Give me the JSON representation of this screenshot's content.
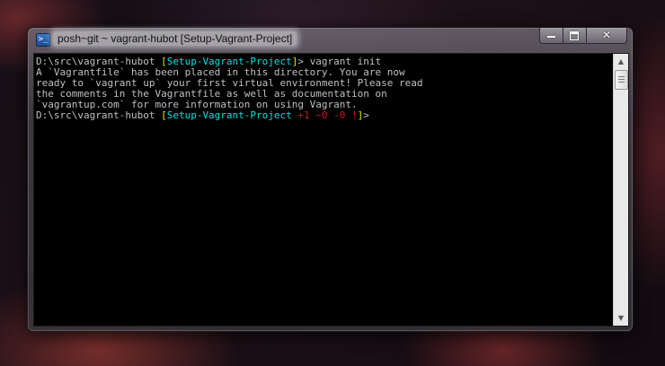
{
  "window": {
    "title": "posh~git ~ vagrant-hubot [Setup-Vagrant-Project]",
    "icon": "powershell-icon",
    "controls": {
      "minimize": "minimize-icon",
      "maximize": "maximize-icon",
      "close_label": "✕"
    }
  },
  "console": {
    "prompt1": {
      "path": "D:\\src\\vagrant-hubot ",
      "open_bracket": "[",
      "branch": "Setup-Vagrant-Project",
      "close_bracket": "]",
      "command": "> vagrant init"
    },
    "output": [
      "A `Vagrantfile` has been placed in this directory. You are now",
      "ready to `vagrant up` your first virtual environment! Please read",
      "the comments in the Vagrantfile as well as documentation on",
      "`vagrantup.com` for more information on using Vagrant."
    ],
    "prompt2": {
      "path": "D:\\src\\vagrant-hubot ",
      "open_bracket": "[",
      "branch": "Setup-Vagrant-Project",
      "status": " +1 ~0 -0 !",
      "close_bracket": "]",
      "cursor": ">"
    }
  },
  "colors": {
    "branch": "#00e0e0",
    "bracket": "#e8e800",
    "status": "#d01818",
    "text": "#c0c0c0"
  }
}
